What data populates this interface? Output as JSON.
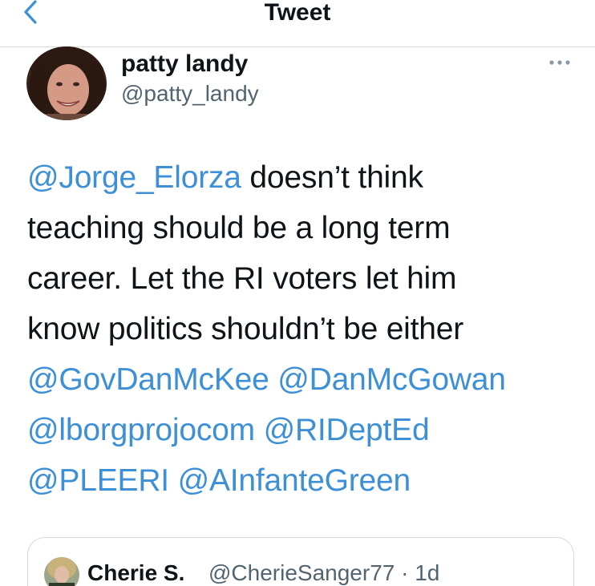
{
  "header": {
    "title": "Tweet",
    "back_icon": "chevron-left-icon"
  },
  "tweet": {
    "author_name": "patty landy",
    "author_handle": "@patty_landy",
    "more_icon": "more-options-icon",
    "lines": [
      [
        {
          "text": "@Jorge_Elorza",
          "mention": true
        },
        {
          "text": " doesn’t think",
          "mention": false
        }
      ],
      [
        {
          "text": "teaching should be a long term",
          "mention": false
        }
      ],
      [
        {
          "text": "career. Let the RI voters let him",
          "mention": false
        }
      ],
      [
        {
          "text": "know politics shouldn’t be either",
          "mention": false
        }
      ],
      [
        {
          "text": "@GovDanMcKee",
          "mention": true
        },
        {
          "text": " ",
          "mention": false
        },
        {
          "text": "@DanMcGowan",
          "mention": true
        }
      ],
      [
        {
          "text": "@lborgprojocom",
          "mention": true
        },
        {
          "text": " ",
          "mention": false
        },
        {
          "text": "@RIDeptEd",
          "mention": true
        }
      ],
      [
        {
          "text": "@PLEERI",
          "mention": true
        },
        {
          "text": " ",
          "mention": false
        },
        {
          "text": "@AInfanteGreen",
          "mention": true
        }
      ]
    ]
  },
  "quoted_tweet": {
    "author_name": "Cherie S.",
    "author_handle_time": "@CherieSanger77 · 1d"
  },
  "colors": {
    "mention": "#3d8fd6",
    "accent": "#1d9bf0",
    "secondary_text": "#536471",
    "border": "#cfd9de"
  }
}
